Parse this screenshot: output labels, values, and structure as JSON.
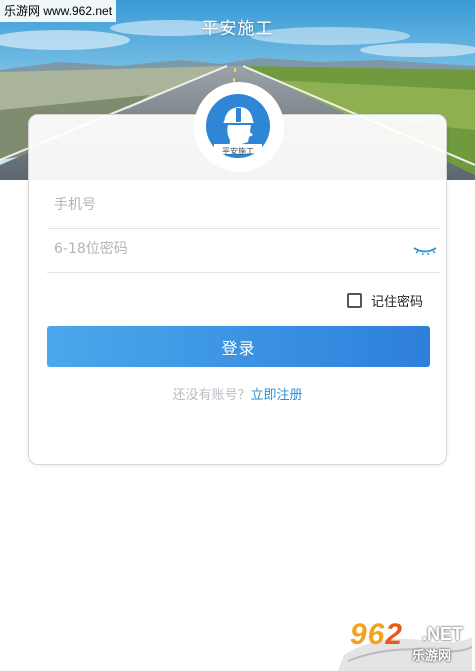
{
  "header": {
    "title": "平安施工",
    "watermark": "乐游网 www.962.net"
  },
  "logo": {
    "label": "平安施工",
    "icon": "helmet-worker-icon"
  },
  "form": {
    "phone_placeholder": "手机号",
    "password_placeholder": "6-18位密码",
    "password_toggle_icon": "eye-closed-icon",
    "remember_label": "记住密码",
    "remember_checked": false,
    "login_label": "登录",
    "register_prompt": "还没有账号？",
    "register_link": "立即注册"
  },
  "footer_watermark": {
    "brand_part1": "96",
    "brand_part2": "2",
    "suffix": ".NET",
    "site_name": "乐游网"
  },
  "colors": {
    "accent_blue": "#2e7fdc",
    "button_gradient_start": "#4aa8ea",
    "link_blue": "#2a8fd6",
    "logo_blue": "#2f86d6"
  }
}
